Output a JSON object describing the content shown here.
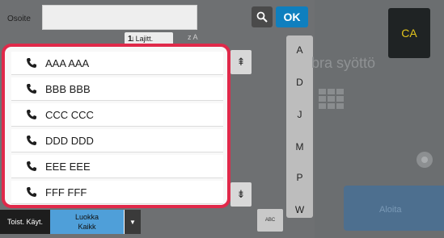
{
  "address": {
    "label": "Osoite",
    "value": "",
    "ok_label": "OK"
  },
  "toolbar": {
    "sort_label": "Lajitt.",
    "sort_az": "z A"
  },
  "index_letters": [
    "A",
    "D",
    "J",
    "M",
    "P",
    "W"
  ],
  "contacts": [
    {
      "name": "AAA AAA"
    },
    {
      "name": "BBB BBB"
    },
    {
      "name": "CCC CCC"
    },
    {
      "name": "DDD DDD"
    },
    {
      "name": "EEE EEE"
    },
    {
      "name": "FFF FFF"
    }
  ],
  "bottom_bar": {
    "frequent_label": "Toist. Käyt.",
    "category_line1": "Luokka",
    "category_line2": "Kaikk"
  },
  "abc_label": "ABC",
  "right_panel": {
    "ca_label": "CA",
    "direct_entry_text": "bra syöttö",
    "start_label": "Aloita"
  },
  "colors": {
    "highlight_border": "#e0294a",
    "ok_blue": "#0f7fbe",
    "category_blue": "#4f9fd9",
    "ca_text": "#e3c51c"
  },
  "icons": [
    "search-icon",
    "phone-icon",
    "scroll-up-icon",
    "scroll-down-icon",
    "dropdown-arrow-icon",
    "keypad-icon"
  ]
}
